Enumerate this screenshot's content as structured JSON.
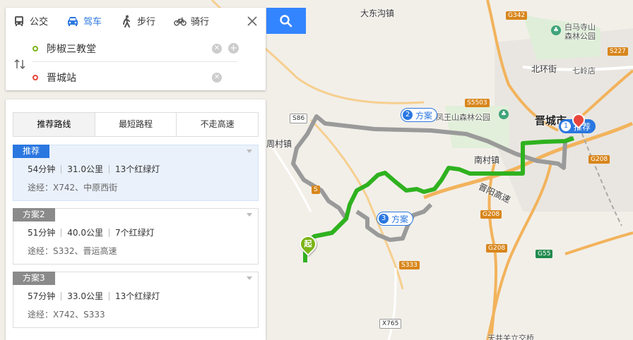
{
  "search": {
    "modes": [
      {
        "label": "公交",
        "icon": "bus-icon"
      },
      {
        "label": "驾车",
        "icon": "car-icon",
        "active": true
      },
      {
        "label": "步行",
        "icon": "walk-icon"
      },
      {
        "label": "骑行",
        "icon": "bike-icon"
      }
    ],
    "origin": "陟椒三教堂",
    "destination": "晋城站"
  },
  "preferences": [
    "推荐路线",
    "最短路程",
    "不走高速"
  ],
  "routes": [
    {
      "badge": "推荐",
      "time": "54分钟",
      "distance": "31.0公里",
      "lights": "13个红绿灯",
      "via": "途经：X742、中原西街",
      "active": true
    },
    {
      "badge": "方案2",
      "time": "51分钟",
      "distance": "40.0公里",
      "lights": "7个红绿灯",
      "via": "途经：S332、晋运高速"
    },
    {
      "badge": "方案3",
      "time": "57分钟",
      "distance": "33.0公里",
      "lights": "13个红绿灯",
      "via": "途经：X742、S333"
    }
  ],
  "map": {
    "places": [
      {
        "name": "大东沟镇",
        "cls": ""
      },
      {
        "name": "白马寺山",
        "cls": "small"
      },
      {
        "name": "森林公园",
        "cls": "small"
      },
      {
        "name": "北环街",
        "cls": ""
      },
      {
        "name": "七岭店",
        "cls": "small"
      },
      {
        "name": "晋城市",
        "cls": "big"
      },
      {
        "name": "周村镇",
        "cls": ""
      },
      {
        "name": "南村镇",
        "cls": ""
      },
      {
        "name": "晋阳高速",
        "cls": ""
      },
      {
        "name": "天井关立交桥",
        "cls": "small"
      },
      {
        "name": "凤王山森林公园",
        "cls": "small"
      }
    ],
    "shields": [
      "G342",
      "S227",
      "S5503",
      "G208",
      "S86",
      "S",
      "G208",
      "G208",
      "G55",
      "S333",
      "X765"
    ],
    "route_tags": [
      {
        "num": "1",
        "label": "推荐"
      },
      {
        "num": "2",
        "label": "方案"
      },
      {
        "num": "3",
        "label": "方案"
      }
    ],
    "start_label": "起",
    "colors": {
      "recommended": "#2fb21f",
      "alt": "#9a9a9a",
      "accent": "#2a77e0"
    }
  }
}
